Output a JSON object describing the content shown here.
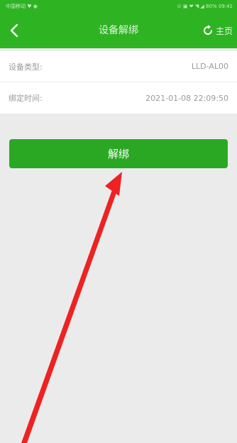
{
  "status_bar": {
    "left_text": "中国移动 ♥ ◉",
    "right_text": "⊙ ▣ ❤ ◥ ◢ 80% 09:41"
  },
  "header": {
    "title": "设备解绑",
    "home_label": "主页"
  },
  "device_info": {
    "rows": [
      {
        "label": "设备类型:",
        "value": "LLD-AL00"
      },
      {
        "label": "绑定时间:",
        "value": "2021-01-08 22:09:50"
      }
    ]
  },
  "actions": {
    "unbind_label": "解绑"
  },
  "annotation": {
    "arrow_color": "#ee2222"
  }
}
